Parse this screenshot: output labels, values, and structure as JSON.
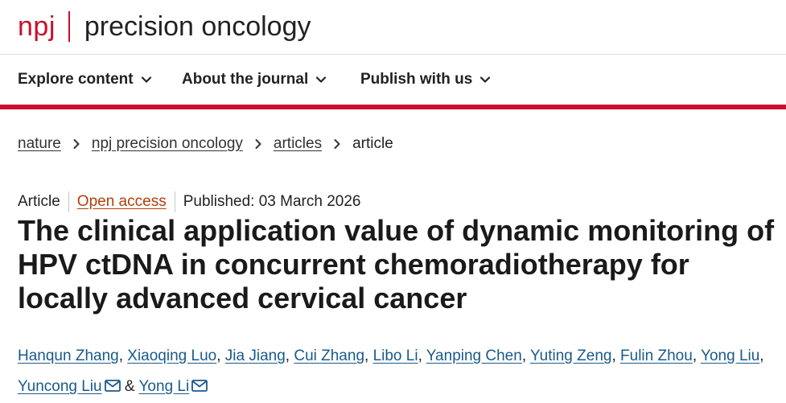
{
  "header": {
    "brand": "npj",
    "journal": "precision oncology"
  },
  "nav": {
    "items": [
      {
        "label": "Explore content"
      },
      {
        "label": "About the journal"
      },
      {
        "label": "Publish with us"
      }
    ]
  },
  "breadcrumb": {
    "items": [
      "nature",
      "npj precision oncology",
      "articles",
      "article"
    ]
  },
  "article": {
    "type": "Article",
    "access": "Open access",
    "published": "Published: 03 March 2026",
    "title": "The clinical application value of dynamic monitoring of HPV ctDNA in concurrent chemoradiotherapy for locally advanced cervical cancer",
    "authors": [
      "Hanqun Zhang",
      "Xiaoqing Luo",
      "Jia Jiang",
      "Cui Zhang",
      "Libo Li",
      "Yanping Chen",
      "Yuting Zeng",
      "Fulin Zhou",
      "Yong Liu",
      "Yuncong Liu",
      "Yong Li"
    ],
    "author_separator": ",",
    "author_conjunction": "&"
  },
  "colors": {
    "brand_red": "#c8102e",
    "open_access": "#b33e0a",
    "author_link": "#1a5a8a"
  }
}
